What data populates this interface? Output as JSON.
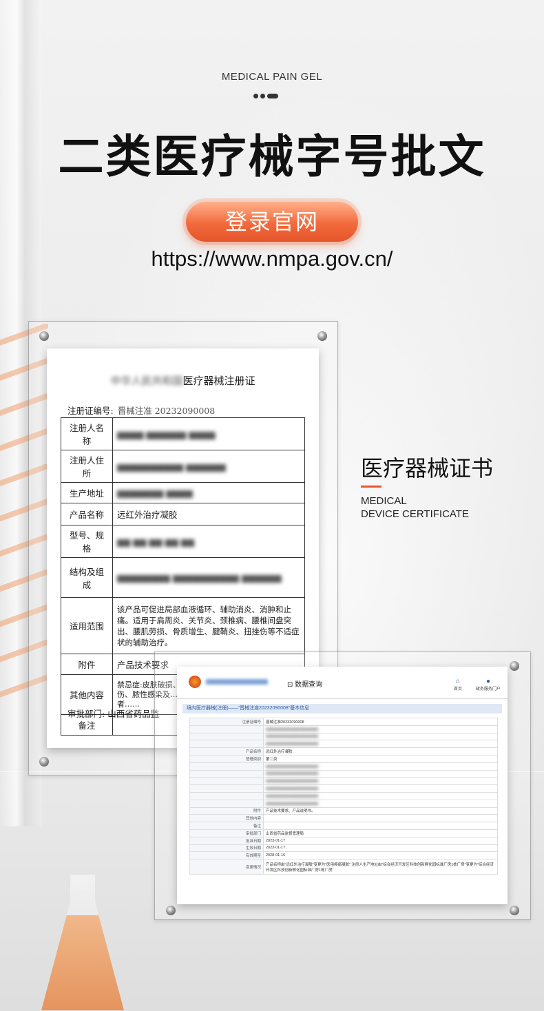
{
  "header": {
    "kicker": "MEDICAL PAIN GEL",
    "title": "二类医疗械字号批文",
    "login_button": "登录官网",
    "url": "https://www.nmpa.gov.cn/"
  },
  "certificate": {
    "title_blurred": "中华人民共和国",
    "title": "医疗器械注册证",
    "reg_no_label": "注册证编号:",
    "reg_no_value": "晋械注准 20232090008",
    "rows": [
      {
        "label": "注册人名称",
        "value": ""
      },
      {
        "label": "注册人住所",
        "value": ""
      },
      {
        "label": "生产地址",
        "value": ""
      },
      {
        "label": "产品名称",
        "value": "远红外治疗凝胶"
      },
      {
        "label": "型号、规格",
        "value": ""
      },
      {
        "label": "结构及组成",
        "value": ""
      },
      {
        "label": "适用范围",
        "value": "该产品可促进局部血液循环、辅助消炎、消肿和止痛。适用于肩周炎、关节炎、颈椎病、腰椎间盘突出、腰肌劳损、骨质增生、腱鞘炎、扭挫伤等不适症状的辅助治疗。"
      },
      {
        "label": "附件",
        "value": "产品技术要求"
      },
      {
        "label": "其他内容",
        "value": "禁忌症:皮肤破损、溃烂、感觉障碍、急性闭合性损伤、脓性感染及……孕妇……精神类患者……材质过敏者……"
      },
      {
        "label": "备注",
        "value": ""
      }
    ],
    "dept_label": "审批部门:",
    "dept_value": "山西省药品监"
  },
  "side_caption": {
    "cn": "医疗器械证书",
    "en_line1": "MEDICAL",
    "en_line2": "DEVICE CERTIFICATE"
  },
  "website": {
    "search_label": "数据查询",
    "nav_home": "首页",
    "nav_user": "政务服务门户",
    "breadcrumb": "境内医疗器械(注册)——“晋械注准20232090008”基本信息",
    "rows": [
      {
        "label": "注册证编号",
        "value": "晋械注准20232090008"
      },
      {
        "label": "",
        "value": ""
      },
      {
        "label": "",
        "value": ""
      },
      {
        "label": "",
        "value": ""
      },
      {
        "label": "产品名称",
        "value": "远红外治疗凝胶"
      },
      {
        "label": "管理类别",
        "value": "第二类"
      },
      {
        "label": "",
        "value": ""
      },
      {
        "label": "",
        "value": ""
      },
      {
        "label": "",
        "value": ""
      },
      {
        "label": "",
        "value": ""
      },
      {
        "label": "",
        "value": ""
      },
      {
        "label": "",
        "value": ""
      },
      {
        "label": "附件",
        "value": "产品技术要求、产品说明书。"
      },
      {
        "label": "其他内容",
        "value": ""
      },
      {
        "label": "备注",
        "value": ""
      },
      {
        "label": "审批部门",
        "value": "山西省药品监督管理局"
      },
      {
        "label": "批准日期",
        "value": "2023-01-17"
      },
      {
        "label": "生效日期",
        "value": "2023-01-17"
      },
      {
        "label": "有效期至",
        "value": "2028-01-16"
      },
      {
        "label": "变更情况",
        "value": "产品名称由“远红外治疗凝胶”变更为“医用疼痛凝胶”,注册人生产地址由“综合经济开发区科技创新孵化园标准厂房1栋厂房”变更为“综合经济开发区科技创新孵化园标准厂房1栋厂房”"
      }
    ]
  }
}
